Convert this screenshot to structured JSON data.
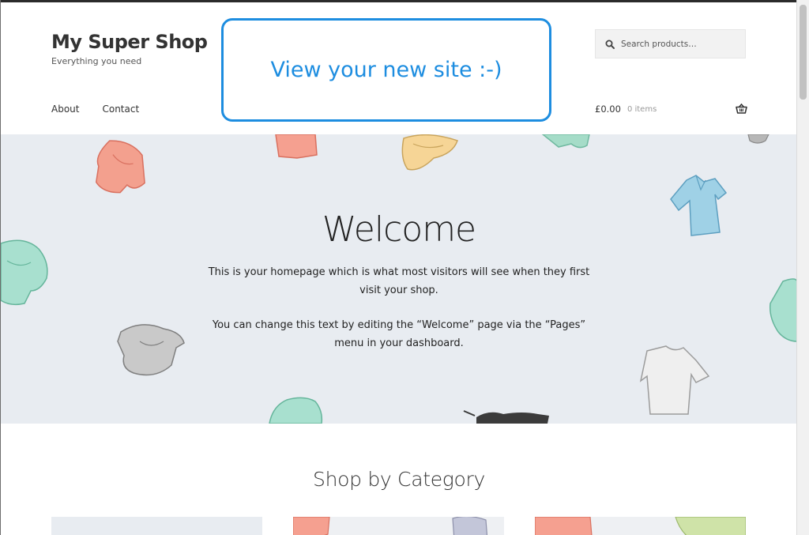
{
  "site": {
    "title": "My Super Shop",
    "tagline": "Everything you need"
  },
  "search": {
    "placeholder": "Search products…"
  },
  "nav": {
    "items": [
      {
        "label": "About"
      },
      {
        "label": "Contact"
      }
    ]
  },
  "cart": {
    "total": "£0.00",
    "count": "0 items"
  },
  "callout": {
    "text": "View your new site :-)"
  },
  "hero": {
    "title": "Welcome",
    "paragraph1": "This is your homepage which is what most visitors will see when they first visit your shop.",
    "paragraph2": "You can change this text by editing the “Welcome” page via the “Pages” menu in your dashboard."
  },
  "categories": {
    "heading": "Shop by Category"
  },
  "icons": {
    "search": "search-icon",
    "cart": "basket-icon"
  },
  "colors": {
    "callout": "#1d8de0",
    "hero_bg": "#e8ecf1"
  }
}
